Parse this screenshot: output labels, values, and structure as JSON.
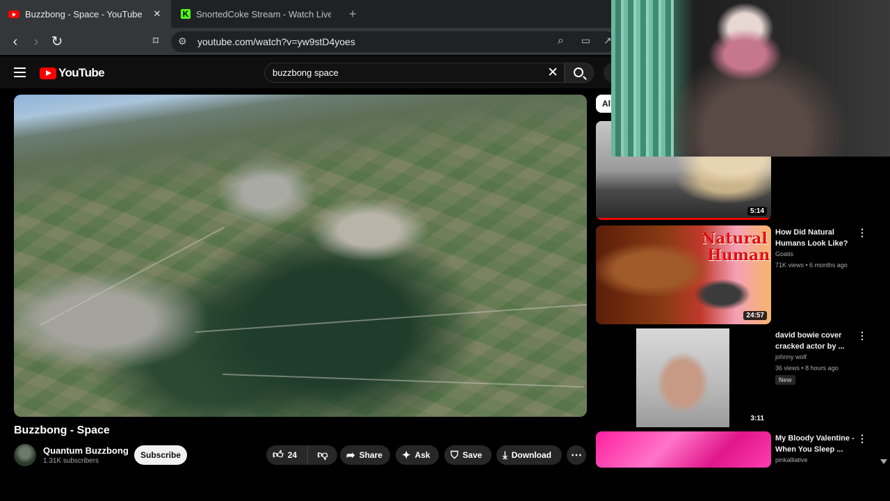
{
  "browser": {
    "tabs": [
      {
        "title": "Buzzbong - Space - YouTube",
        "close": "✕"
      },
      {
        "title": "SnortedCoke Stream - Watch Live on"
      }
    ],
    "new_tab": "+",
    "url": "youtube.com/watch?v=yw9stD4yoes"
  },
  "youtube": {
    "logo_text": "YouTube",
    "search_query": "buzzbong space",
    "clear_icon": "✕"
  },
  "video": {
    "title": "Buzzbong - Space",
    "channel": "Quantum Buzzbong",
    "subscribers": "1.31K subscribers",
    "subscribe_label": "Subscribe",
    "likes": "24",
    "actions": {
      "share": "Share",
      "ask": "Ask",
      "save": "Save",
      "download": "Download"
    }
  },
  "sidebar": {
    "chip": "All",
    "recommendations": [
      {
        "duration": "5:14",
        "title": "",
        "channel": "",
        "meta": ""
      },
      {
        "duration": "24:57",
        "title": "How Did Natural Humans Look Like?",
        "channel": "Goatis",
        "meta": "71K views • 6 months ago",
        "thumb_text_1": "Natural",
        "thumb_text_2": "Human"
      },
      {
        "duration": "3:11",
        "title": "david bowie cover cracked actor by ...",
        "channel": "johnny wolf",
        "meta": "36 views • 8 hours ago",
        "badge": "New"
      },
      {
        "title": "My Bloody Valentine - When You Sleep ...",
        "channel": "pinkalliative"
      }
    ]
  },
  "colors": {
    "brand_red": "#ff0000",
    "background": "#0f0f0f",
    "pill": "#272727"
  }
}
